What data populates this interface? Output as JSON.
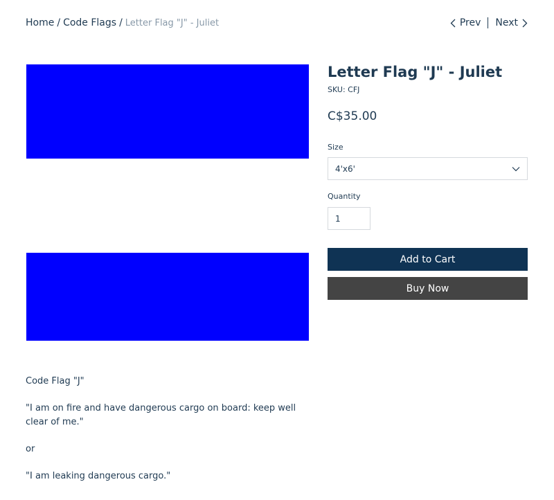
{
  "breadcrumb": {
    "home": "Home",
    "separator": "/",
    "category": "Code Flags",
    "current": "Letter Flag \"J\" - Juliet"
  },
  "pager": {
    "prev_label": "Prev",
    "next_label": "Next"
  },
  "product": {
    "title": "Letter Flag \"J\" - Juliet",
    "sku": "SKU: CFJ",
    "price": "C$35.00",
    "flag_color": "#0000ff"
  },
  "options": {
    "size_label": "Size",
    "size_value": "4'x6'",
    "quantity_label": "Quantity",
    "quantity_value": "1"
  },
  "actions": {
    "add_to_cart": "Add to Cart",
    "buy_now": "Buy Now"
  },
  "description": [
    "Code Flag \"J\"",
    "\"I am on fire and have dangerous cargo on board: keep well clear of me.\"",
    "or",
    "\"I am leaking dangerous cargo.\""
  ],
  "colors": {
    "text": "#1f3a52",
    "add_to_cart_bg": "#0f3354",
    "buy_now_bg": "#444444",
    "breadcrumb_current": "#8899a8"
  }
}
